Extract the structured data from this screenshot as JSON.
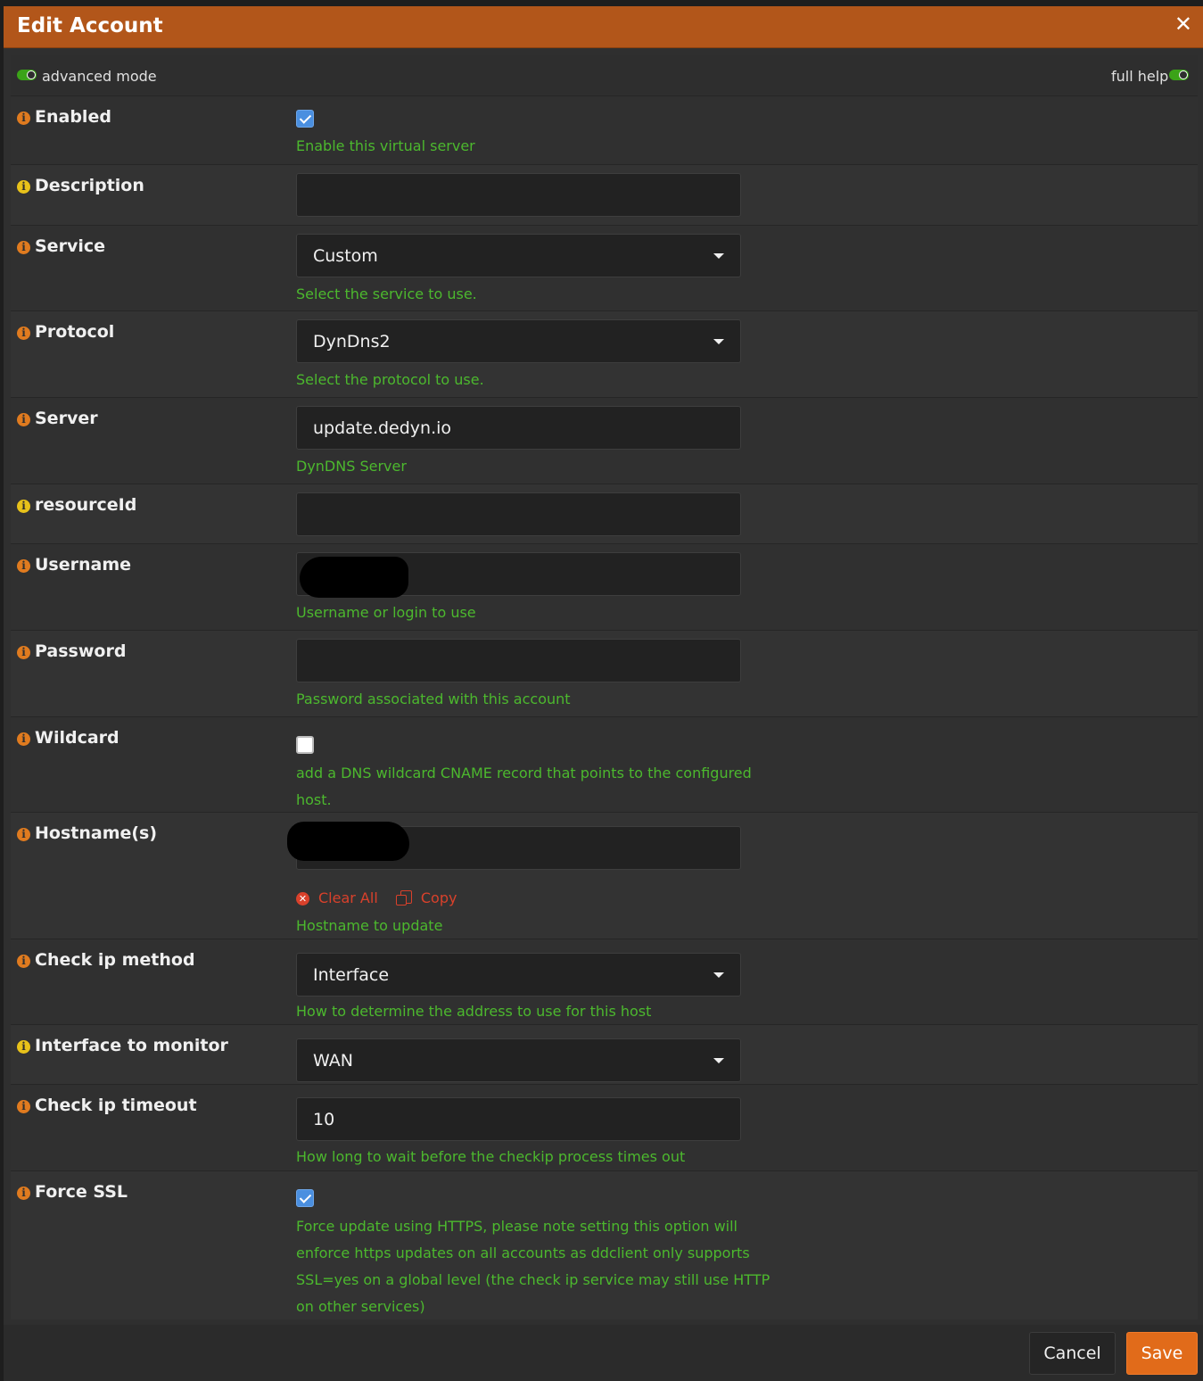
{
  "dialog": {
    "title": "Edit Account",
    "close_glyph": "✕"
  },
  "modebar": {
    "advanced_label": "advanced mode",
    "full_help_label": "full help"
  },
  "fields": {
    "enabled": {
      "label": "Enabled",
      "checked": true,
      "help": "Enable this virtual server"
    },
    "description": {
      "label": "Description",
      "value": ""
    },
    "service": {
      "label": "Service",
      "value": "Custom",
      "help": "Select the service to use."
    },
    "protocol": {
      "label": "Protocol",
      "value": "DynDns2",
      "help": "Select the protocol to use."
    },
    "server": {
      "label": "Server",
      "value": "update.dedyn.io",
      "help": "DynDNS Server"
    },
    "resourceid": {
      "label": "resourceId",
      "value": ""
    },
    "username": {
      "label": "Username",
      "help": "Username or login to use"
    },
    "password": {
      "label": "Password",
      "value": "",
      "help": "Password associated with this account"
    },
    "wildcard": {
      "label": "Wildcard",
      "checked": false,
      "help_line1": "add a DNS wildcard CNAME record that points to the configured",
      "help_line2": "host."
    },
    "hostnames": {
      "label": "Hostname(s)",
      "clear_all": "Clear All",
      "copy": "Copy",
      "help": "Hostname to update"
    },
    "checkip_method": {
      "label": "Check ip method",
      "value": "Interface",
      "help": "How to determine the address to use for this host"
    },
    "interface": {
      "label": "Interface to monitor",
      "value": "WAN"
    },
    "checkip_timeout": {
      "label": "Check ip timeout",
      "value": "10",
      "help": "How long to wait before the checkip process times out"
    },
    "force_ssl": {
      "label": "Force SSL",
      "checked": true,
      "help_line1": "Force update using HTTPS, please note setting this option will",
      "help_line2": "enforce https updates on all accounts as ddclient only supports",
      "help_line3": "SSL=yes on a global level (the check ip service may still use HTTP",
      "help_line4": "on other services)"
    }
  },
  "footer": {
    "cancel_label": "Cancel",
    "save_label": "Save"
  },
  "colors": {
    "header": "#b2561a",
    "help_text": "#4cb82e",
    "accent": "#e16b1a",
    "link": "#d9412b"
  }
}
